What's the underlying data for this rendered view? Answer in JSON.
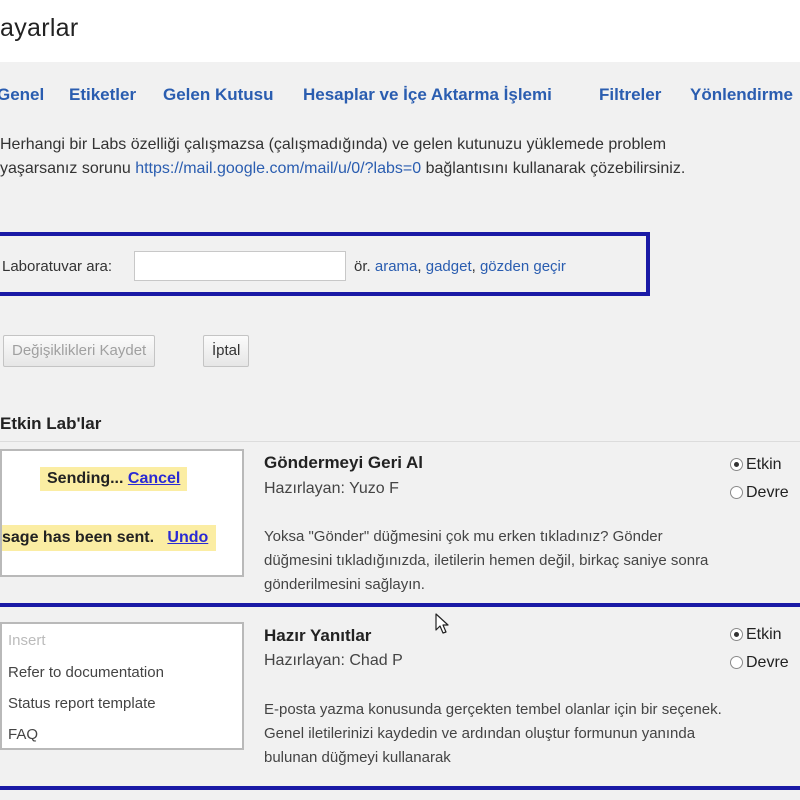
{
  "header": {
    "title": "ayarlar"
  },
  "tabs": [
    {
      "label": "Genel"
    },
    {
      "label": "Etiketler"
    },
    {
      "label": "Gelen Kutusu"
    },
    {
      "label": "Hesaplar ve İçe Aktarma İşlemi"
    },
    {
      "label": "Filtreler"
    },
    {
      "label": "Yönlendirme"
    }
  ],
  "info": {
    "text_before": "Herhangi bir Labs özelliği çalışmazsa (çalışmadığında) ve gelen kutunuzu yüklemede problem yaşarsanız sorunu ",
    "link": "https://mail.google.com/mail/u/0/?labs=0",
    "text_after": " bağlantısını kullanarak çözebilirsiniz."
  },
  "search": {
    "label": "Laboratuvar ara:",
    "value": "",
    "placeholder": "",
    "hint_prefix": "ör.",
    "examples": [
      "arama",
      "gadget",
      "gözden geçir"
    ]
  },
  "actions": {
    "save_label": "Değişiklikleri Kaydet",
    "cancel_label": "İptal"
  },
  "section": {
    "title": "Etkin Lab'lar"
  },
  "labs": [
    {
      "name": "Göndermeyi Geri Al",
      "author": "Hazırlayan: Yuzo F",
      "description": "Yoksa \"Gönder\" düğmesini çok mu erken tıkladınız? Gönder düğmesini tıkladığınızda, iletilerin hemen değil, birkaç saniye sonra gönderilmesini sağlayın.",
      "options": [
        "Etkin",
        "Devre"
      ],
      "selected": "Etkin",
      "preview": {
        "sending": "Sending...",
        "cancel": "Cancel",
        "sent": "sage has been sent.",
        "undo": "Undo"
      }
    },
    {
      "name": "Hazır Yanıtlar",
      "author": "Hazırlayan: Chad P",
      "description": "E-posta yazma konusunda gerçekten tembel olanlar için bir seçenek. Genel iletilerinizi kaydedin ve ardından oluştur formunun yanında bulunan düğmeyi kullanarak",
      "options": [
        "Etkin",
        "Devre"
      ],
      "selected": "Etkin",
      "preview": {
        "insert": "Insert",
        "items": [
          "Refer to documentation",
          "Status report template",
          "FAQ"
        ]
      }
    }
  ],
  "colors": {
    "link": "#2a5db0",
    "highlight": "#1a1aa6",
    "bubble": "#fbeda3"
  }
}
